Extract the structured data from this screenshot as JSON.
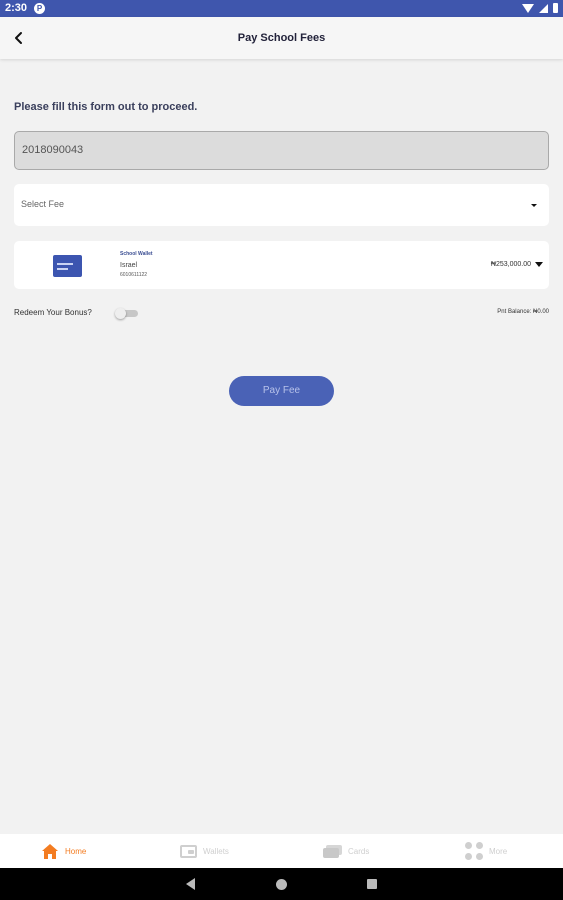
{
  "status_bar": {
    "time": "2:30",
    "app_icon_letter": "P",
    "icons": [
      "wifi-icon",
      "signal-icon",
      "battery-icon"
    ],
    "background": "#3f56ad"
  },
  "header": {
    "title": "Pay School Fees",
    "back_icon": "back-arrow-icon"
  },
  "form": {
    "heading": "Please fill this form out to proceed.",
    "student_id_value": "2018090043",
    "fee_select": {
      "placeholder": "Select Fee",
      "icon": "caret-down-icon"
    },
    "wallet": {
      "title": "School Wallet",
      "name": "Israel",
      "number": "6010611122",
      "balance": "₦253,000.00",
      "icon": "wallet-card-icon"
    },
    "redeem_label": "Redeem Your Bonus?",
    "redeem_toggle_on": false,
    "points_balance": "Pnt Balance: ₦0.00",
    "pay_button_label": "Pay Fee"
  },
  "bottom_nav": {
    "active_color": "#f37c21",
    "items": [
      {
        "label": "Home",
        "icon": "home-icon",
        "active": true
      },
      {
        "label": "Wallets",
        "icon": "wallet-icon",
        "active": false
      },
      {
        "label": "Cards",
        "icon": "cards-icon",
        "active": false
      },
      {
        "label": "More",
        "icon": "more-icon",
        "active": false
      }
    ]
  },
  "system_nav": {
    "icons": [
      "back-triangle-icon",
      "home-circle-icon",
      "recents-square-icon"
    ]
  }
}
